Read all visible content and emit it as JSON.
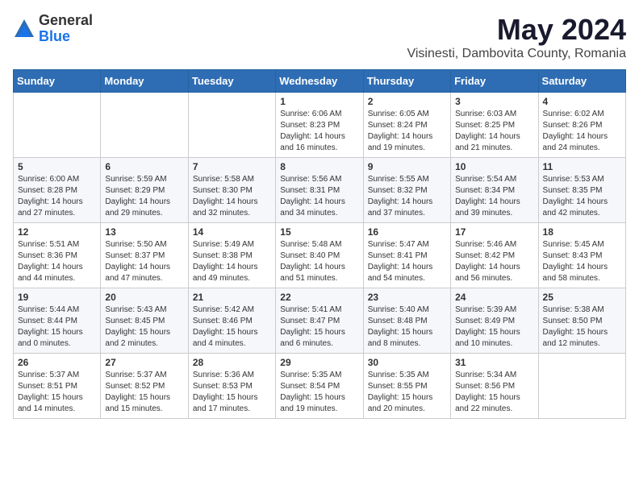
{
  "logo": {
    "general": "General",
    "blue": "Blue"
  },
  "title": {
    "month_year": "May 2024",
    "location": "Visinesti, Dambovita County, Romania"
  },
  "weekdays": [
    "Sunday",
    "Monday",
    "Tuesday",
    "Wednesday",
    "Thursday",
    "Friday",
    "Saturday"
  ],
  "weeks": [
    [
      {
        "day": "",
        "info": ""
      },
      {
        "day": "",
        "info": ""
      },
      {
        "day": "",
        "info": ""
      },
      {
        "day": "1",
        "info": "Sunrise: 6:06 AM\nSunset: 8:23 PM\nDaylight: 14 hours\nand 16 minutes."
      },
      {
        "day": "2",
        "info": "Sunrise: 6:05 AM\nSunset: 8:24 PM\nDaylight: 14 hours\nand 19 minutes."
      },
      {
        "day": "3",
        "info": "Sunrise: 6:03 AM\nSunset: 8:25 PM\nDaylight: 14 hours\nand 21 minutes."
      },
      {
        "day": "4",
        "info": "Sunrise: 6:02 AM\nSunset: 8:26 PM\nDaylight: 14 hours\nand 24 minutes."
      }
    ],
    [
      {
        "day": "5",
        "info": "Sunrise: 6:00 AM\nSunset: 8:28 PM\nDaylight: 14 hours\nand 27 minutes."
      },
      {
        "day": "6",
        "info": "Sunrise: 5:59 AM\nSunset: 8:29 PM\nDaylight: 14 hours\nand 29 minutes."
      },
      {
        "day": "7",
        "info": "Sunrise: 5:58 AM\nSunset: 8:30 PM\nDaylight: 14 hours\nand 32 minutes."
      },
      {
        "day": "8",
        "info": "Sunrise: 5:56 AM\nSunset: 8:31 PM\nDaylight: 14 hours\nand 34 minutes."
      },
      {
        "day": "9",
        "info": "Sunrise: 5:55 AM\nSunset: 8:32 PM\nDaylight: 14 hours\nand 37 minutes."
      },
      {
        "day": "10",
        "info": "Sunrise: 5:54 AM\nSunset: 8:34 PM\nDaylight: 14 hours\nand 39 minutes."
      },
      {
        "day": "11",
        "info": "Sunrise: 5:53 AM\nSunset: 8:35 PM\nDaylight: 14 hours\nand 42 minutes."
      }
    ],
    [
      {
        "day": "12",
        "info": "Sunrise: 5:51 AM\nSunset: 8:36 PM\nDaylight: 14 hours\nand 44 minutes."
      },
      {
        "day": "13",
        "info": "Sunrise: 5:50 AM\nSunset: 8:37 PM\nDaylight: 14 hours\nand 47 minutes."
      },
      {
        "day": "14",
        "info": "Sunrise: 5:49 AM\nSunset: 8:38 PM\nDaylight: 14 hours\nand 49 minutes."
      },
      {
        "day": "15",
        "info": "Sunrise: 5:48 AM\nSunset: 8:40 PM\nDaylight: 14 hours\nand 51 minutes."
      },
      {
        "day": "16",
        "info": "Sunrise: 5:47 AM\nSunset: 8:41 PM\nDaylight: 14 hours\nand 54 minutes."
      },
      {
        "day": "17",
        "info": "Sunrise: 5:46 AM\nSunset: 8:42 PM\nDaylight: 14 hours\nand 56 minutes."
      },
      {
        "day": "18",
        "info": "Sunrise: 5:45 AM\nSunset: 8:43 PM\nDaylight: 14 hours\nand 58 minutes."
      }
    ],
    [
      {
        "day": "19",
        "info": "Sunrise: 5:44 AM\nSunset: 8:44 PM\nDaylight: 15 hours\nand 0 minutes."
      },
      {
        "day": "20",
        "info": "Sunrise: 5:43 AM\nSunset: 8:45 PM\nDaylight: 15 hours\nand 2 minutes."
      },
      {
        "day": "21",
        "info": "Sunrise: 5:42 AM\nSunset: 8:46 PM\nDaylight: 15 hours\nand 4 minutes."
      },
      {
        "day": "22",
        "info": "Sunrise: 5:41 AM\nSunset: 8:47 PM\nDaylight: 15 hours\nand 6 minutes."
      },
      {
        "day": "23",
        "info": "Sunrise: 5:40 AM\nSunset: 8:48 PM\nDaylight: 15 hours\nand 8 minutes."
      },
      {
        "day": "24",
        "info": "Sunrise: 5:39 AM\nSunset: 8:49 PM\nDaylight: 15 hours\nand 10 minutes."
      },
      {
        "day": "25",
        "info": "Sunrise: 5:38 AM\nSunset: 8:50 PM\nDaylight: 15 hours\nand 12 minutes."
      }
    ],
    [
      {
        "day": "26",
        "info": "Sunrise: 5:37 AM\nSunset: 8:51 PM\nDaylight: 15 hours\nand 14 minutes."
      },
      {
        "day": "27",
        "info": "Sunrise: 5:37 AM\nSunset: 8:52 PM\nDaylight: 15 hours\nand 15 minutes."
      },
      {
        "day": "28",
        "info": "Sunrise: 5:36 AM\nSunset: 8:53 PM\nDaylight: 15 hours\nand 17 minutes."
      },
      {
        "day": "29",
        "info": "Sunrise: 5:35 AM\nSunset: 8:54 PM\nDaylight: 15 hours\nand 19 minutes."
      },
      {
        "day": "30",
        "info": "Sunrise: 5:35 AM\nSunset: 8:55 PM\nDaylight: 15 hours\nand 20 minutes."
      },
      {
        "day": "31",
        "info": "Sunrise: 5:34 AM\nSunset: 8:56 PM\nDaylight: 15 hours\nand 22 minutes."
      },
      {
        "day": "",
        "info": ""
      }
    ]
  ]
}
